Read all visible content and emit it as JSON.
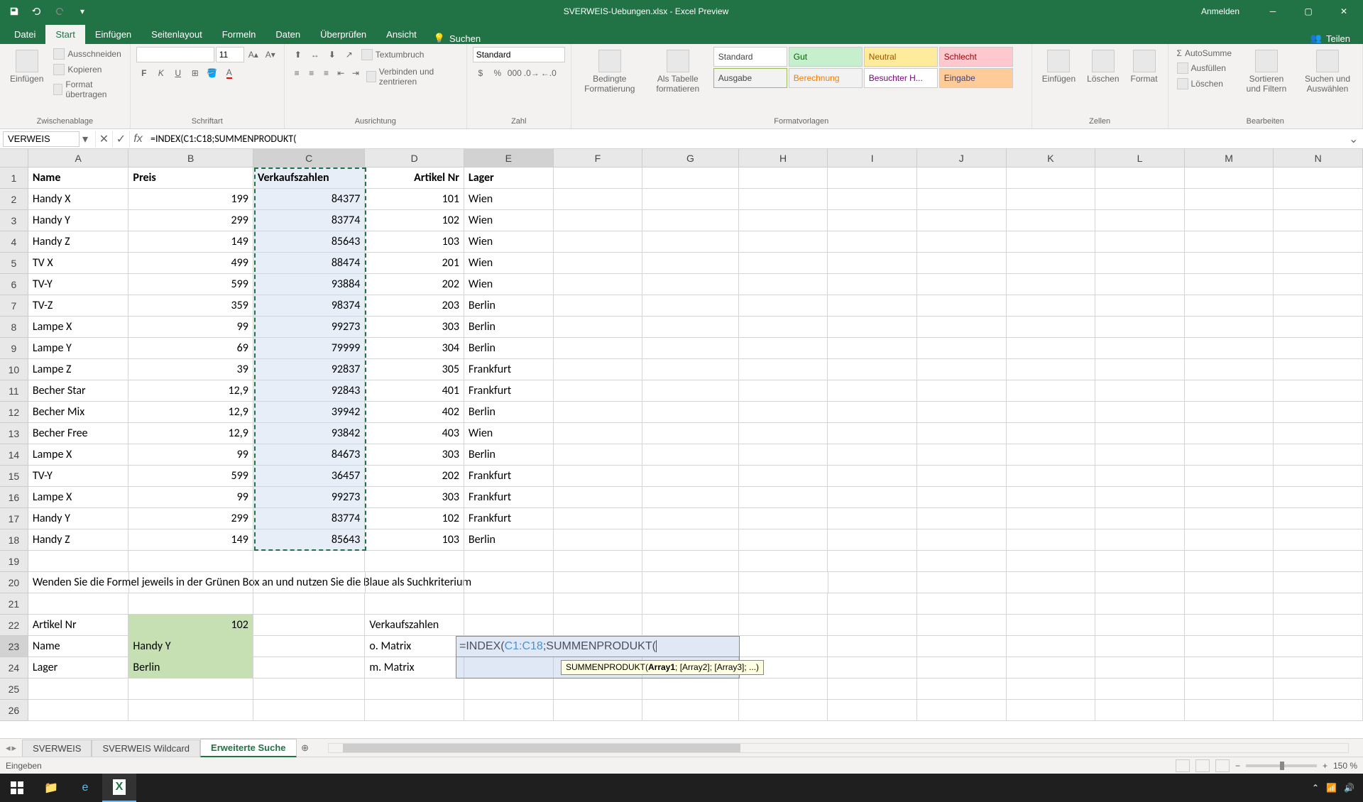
{
  "title": "SVERWEIS-Uebungen.xlsx - Excel Preview",
  "user_action": "Anmelden",
  "share": "Teilen",
  "tabs": [
    "Datei",
    "Start",
    "Einfügen",
    "Seitenlayout",
    "Formeln",
    "Daten",
    "Überprüfen",
    "Ansicht"
  ],
  "search_label": "Suchen",
  "clipboard": {
    "paste": "Einfügen",
    "cut": "Ausschneiden",
    "copy": "Kopieren",
    "format_painter": "Format übertragen",
    "group": "Zwischenablage"
  },
  "font": {
    "size": "11",
    "group": "Schriftart"
  },
  "alignment": {
    "wrap": "Textumbruch",
    "merge": "Verbinden und zentrieren",
    "group": "Ausrichtung"
  },
  "number": {
    "format": "Standard",
    "group": "Zahl"
  },
  "styles": {
    "cond": "Bedingte Formatierung",
    "table": "Als Tabelle formatieren",
    "items": [
      "Standard",
      "Gut",
      "Neutral",
      "Schlecht",
      "Ausgabe",
      "Berechnung",
      "Besuchter H...",
      "Eingabe"
    ],
    "group": "Formatvorlagen"
  },
  "cells": {
    "insert": "Einfügen",
    "delete": "Löschen",
    "format": "Format",
    "group": "Zellen"
  },
  "editing": {
    "autosum": "AutoSumme",
    "fill": "Ausfüllen",
    "clear": "Löschen",
    "sort": "Sortieren und Filtern",
    "find": "Suchen und Auswählen",
    "group": "Bearbeiten"
  },
  "name_box": "VERWEIS",
  "formula": "=INDEX(C1:C18;SUMMENPRODUKT(",
  "tooltip": {
    "fn": "SUMMENPRODUKT(",
    "arg1": "Array1",
    "rest": "; [Array2]; [Array3]; ...)"
  },
  "columns": [
    "A",
    "B",
    "C",
    "D",
    "E",
    "F",
    "G",
    "H",
    "I",
    "J",
    "K",
    "L",
    "M",
    "N"
  ],
  "headers": {
    "a": "Name",
    "b": "Preis",
    "c": "Verkaufszahlen",
    "d": "Artikel Nr",
    "e": "Lager"
  },
  "rows": [
    {
      "a": "Handy X",
      "b": "199",
      "c": "84377",
      "d": "101",
      "e": "Wien"
    },
    {
      "a": "Handy Y",
      "b": "299",
      "c": "83774",
      "d": "102",
      "e": "Wien"
    },
    {
      "a": "Handy Z",
      "b": "149",
      "c": "85643",
      "d": "103",
      "e": "Wien"
    },
    {
      "a": "TV X",
      "b": "499",
      "c": "88474",
      "d": "201",
      "e": "Wien"
    },
    {
      "a": "TV-Y",
      "b": "599",
      "c": "93884",
      "d": "202",
      "e": "Wien"
    },
    {
      "a": "TV-Z",
      "b": "359",
      "c": "98374",
      "d": "203",
      "e": "Berlin"
    },
    {
      "a": "Lampe X",
      "b": "99",
      "c": "99273",
      "d": "303",
      "e": "Berlin"
    },
    {
      "a": "Lampe Y",
      "b": "69",
      "c": "79999",
      "d": "304",
      "e": "Berlin"
    },
    {
      "a": "Lampe Z",
      "b": "39",
      "c": "92837",
      "d": "305",
      "e": "Frankfurt"
    },
    {
      "a": "Becher Star",
      "b": "12,9",
      "c": "92843",
      "d": "401",
      "e": "Frankfurt"
    },
    {
      "a": "Becher Mix",
      "b": "12,9",
      "c": "39942",
      "d": "402",
      "e": "Berlin"
    },
    {
      "a": "Becher Free",
      "b": "12,9",
      "c": "93842",
      "d": "403",
      "e": "Wien"
    },
    {
      "a": "Lampe X",
      "b": "99",
      "c": "84673",
      "d": "303",
      "e": "Berlin"
    },
    {
      "a": "TV-Y",
      "b": "599",
      "c": "36457",
      "d": "202",
      "e": "Frankfurt"
    },
    {
      "a": "Lampe X",
      "b": "99",
      "c": "99273",
      "d": "303",
      "e": "Frankfurt"
    },
    {
      "a": "Handy Y",
      "b": "299",
      "c": "83774",
      "d": "102",
      "e": "Frankfurt"
    },
    {
      "a": "Handy Z",
      "b": "149",
      "c": "85643",
      "d": "103",
      "e": "Berlin"
    }
  ],
  "instruction": "Wenden Sie die Formel jeweils in der Grünen Box an und nutzen Sie die Blaue als Suchkriterium",
  "lookup": {
    "artikel_label": "Artikel Nr",
    "artikel_val": "102",
    "name_label": "Name",
    "name_val": "Handy Y",
    "lager_label": "Lager",
    "lager_val": "Berlin",
    "vk_label": "Verkaufszahlen",
    "omatrix": "o. Matrix",
    "mmatrix": "m. Matrix"
  },
  "cell_formula_display": "=INDEX(C1:C18;SUMMENPRODUKT(",
  "sheets": [
    "SVERWEIS",
    "SVERWEIS Wildcard",
    "Erweiterte Suche"
  ],
  "status": "Eingeben",
  "zoom": "150 %"
}
